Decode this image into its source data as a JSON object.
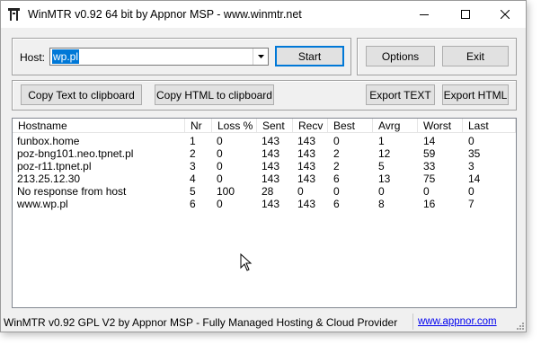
{
  "window": {
    "title": "WinMTR v0.92 64 bit by Appnor MSP - www.winmtr.net",
    "minimize_icon": "minimize-icon",
    "maximize_icon": "maximize-icon",
    "close_icon": "close-icon"
  },
  "host": {
    "label": "Host:",
    "value": "wp.pl",
    "start_label": "Start"
  },
  "side": {
    "options_label": "Options",
    "exit_label": "Exit"
  },
  "toolbar": {
    "copy_text_label": "Copy Text to clipboard",
    "copy_html_label": "Copy HTML to clipboard",
    "export_text_label": "Export TEXT",
    "export_html_label": "Export HTML"
  },
  "table": {
    "columns": [
      "Hostname",
      "Nr",
      "Loss %",
      "Sent",
      "Recv",
      "Best",
      "Avrg",
      "Worst",
      "Last"
    ],
    "rows": [
      [
        "funbox.home",
        "1",
        "0",
        "143",
        "143",
        "0",
        "1",
        "14",
        "0"
      ],
      [
        "poz-bng101.neo.tpnet.pl",
        "2",
        "0",
        "143",
        "143",
        "2",
        "12",
        "59",
        "35"
      ],
      [
        "poz-r11.tpnet.pl",
        "3",
        "0",
        "143",
        "143",
        "2",
        "5",
        "33",
        "3"
      ],
      [
        "213.25.12.30",
        "4",
        "0",
        "143",
        "143",
        "6",
        "13",
        "75",
        "14"
      ],
      [
        "No response from host",
        "5",
        "100",
        "28",
        "0",
        "0",
        "0",
        "0",
        "0"
      ],
      [
        "www.wp.pl",
        "6",
        "0",
        "143",
        "143",
        "6",
        "8",
        "16",
        "7"
      ]
    ]
  },
  "status": {
    "text": "WinMTR v0.92 GPL V2 by Appnor MSP - Fully Managed Hosting & Cloud Provider",
    "link": "www.appnor.com"
  },
  "colors": {
    "accent": "#0078d7",
    "window_bg": "#f0f0f0",
    "link": "#0000ee"
  }
}
